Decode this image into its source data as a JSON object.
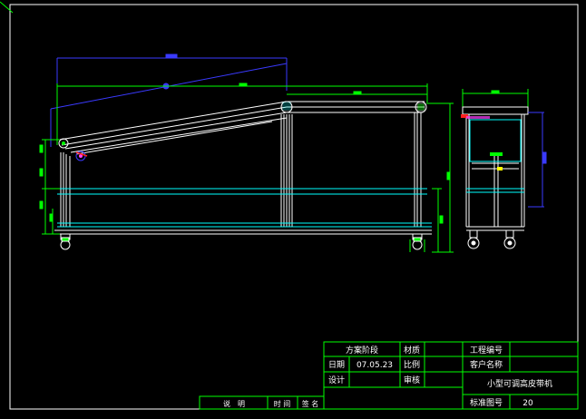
{
  "title_block": {
    "label_scheme": "方案阶段",
    "label_material": "材质",
    "label_project_no": "工程编号",
    "label_date": "日期",
    "value_date": "07.05.23",
    "label_scale": "比例",
    "label_customer": "客户名称",
    "label_design": "设计",
    "label_review": "审核",
    "product_name": "小型可调高皮带机",
    "label_std_drawing_no": "标准图号",
    "value_std_drawing_no": "20"
  },
  "revision_strip": {
    "label_description": "说　明",
    "label_time": "时 间",
    "label_signature": "签 名"
  },
  "colors": {
    "background": "#000000",
    "frame": "#ffffff",
    "title_block_lines": "#00ff00",
    "geometry": "#ffffff",
    "dimension_green": "#00ff00",
    "dimension_blue": "#3a3aff",
    "section_cyan": "#00ffff",
    "accent_red": "#ff2020",
    "accent_magenta": "#ff40ff",
    "accent_yellow": "#ffff00"
  }
}
